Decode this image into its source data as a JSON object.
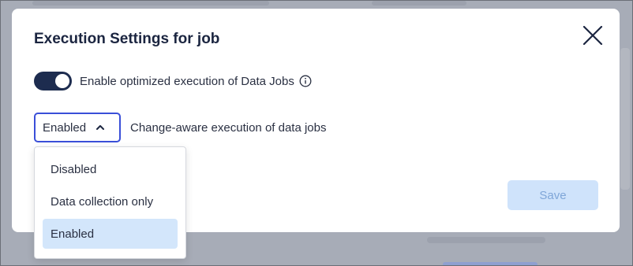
{
  "modal": {
    "title": "Execution Settings for job",
    "toggle_label": "Enable optimized execution of Data Jobs",
    "toggle_on": true,
    "select_value": "Enabled",
    "select_label": "Change-aware execution of data jobs",
    "save_label": "Save"
  },
  "dropdown": {
    "options": [
      "Disabled",
      "Data collection only",
      "Enabled"
    ],
    "selected": "Enabled"
  },
  "colors": {
    "toggle_on": "#1d2c4f",
    "select_border": "#3a4fd8",
    "selected_option_bg": "#d3e6fb",
    "save_disabled_bg": "#cfe3fb"
  },
  "icons": [
    "close-icon",
    "info-icon",
    "chevron-up-icon"
  ]
}
